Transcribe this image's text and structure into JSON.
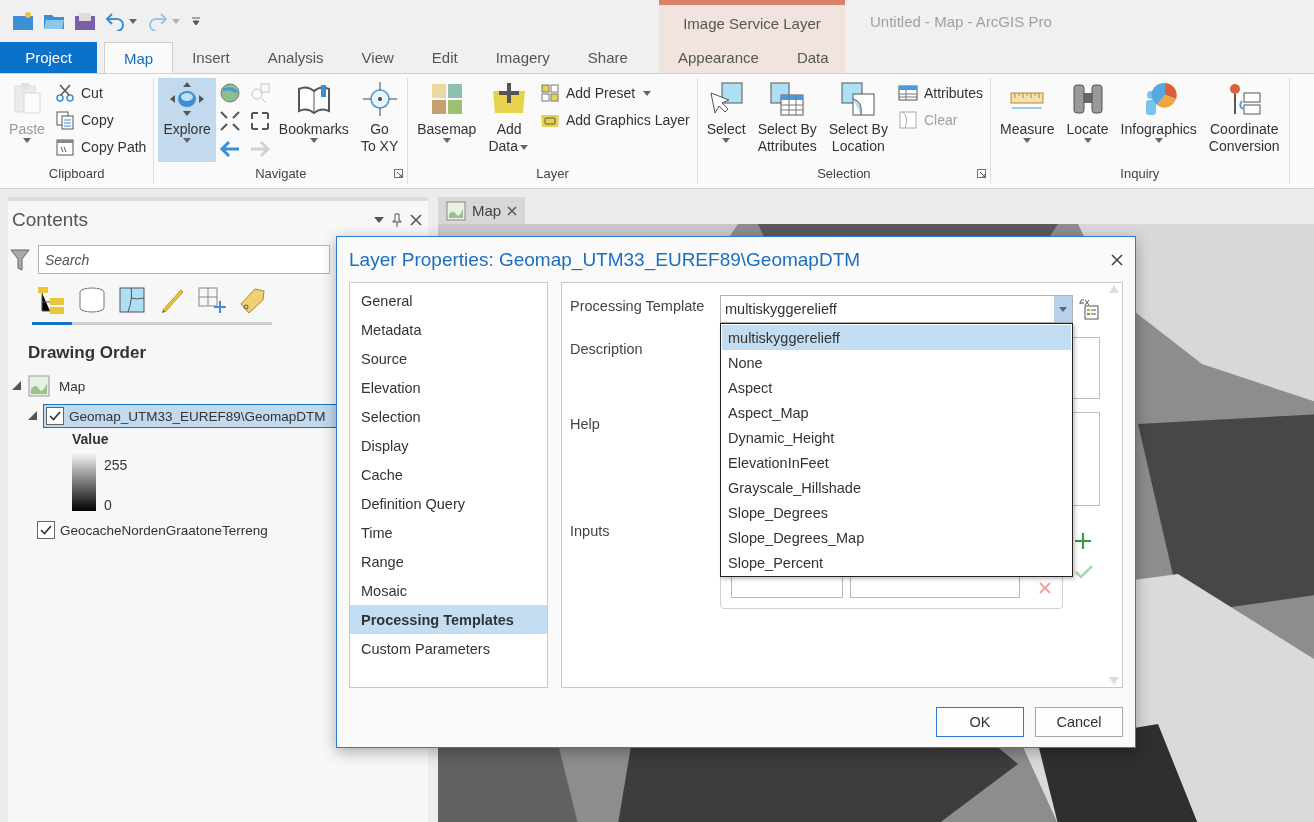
{
  "quick_access": [
    {
      "disabled": false
    },
    {
      "disabled": false
    },
    {
      "disabled": false
    },
    {
      "disabled": false
    },
    {
      "disabled": true
    }
  ],
  "context_tabs": {
    "title": "Image Service Layer",
    "tabs": [
      {
        "label": "Appearance",
        "selected": false
      },
      {
        "label": "Data",
        "selected": false
      }
    ]
  },
  "app_title": "Untitled - Map - ArcGIS Pro",
  "tabs": [
    {
      "label": "Project",
      "kind": "backstage",
      "selected": false
    },
    {
      "label": "Map",
      "kind": "tab",
      "selected": true
    },
    {
      "label": "Insert",
      "kind": "tab",
      "selected": false
    },
    {
      "label": "Analysis",
      "kind": "tab",
      "selected": false
    },
    {
      "label": "View",
      "kind": "tab",
      "selected": false
    },
    {
      "label": "Edit",
      "kind": "tab",
      "selected": false
    },
    {
      "label": "Imagery",
      "kind": "tab",
      "selected": false
    },
    {
      "label": "Share",
      "kind": "tab",
      "selected": false
    }
  ],
  "ribbon": {
    "groups": [
      {
        "title": "Clipboard",
        "launcher": false,
        "items": [
          {
            "kind": "large",
            "lines": [
              "Paste"
            ],
            "dropdown": true,
            "disabled": true,
            "selected": false
          },
          {
            "kind": "stack",
            "buttons": [
              {
                "label": "Cut",
                "disabled": false,
                "dropdown": false
              },
              {
                "label": "Copy",
                "disabled": false,
                "dropdown": false
              },
              {
                "label": "Copy Path",
                "disabled": false,
                "dropdown": false
              }
            ]
          }
        ]
      },
      {
        "title": "Navigate",
        "launcher": true,
        "items": [
          {
            "kind": "large",
            "lines": [
              "Explore"
            ],
            "dropdown": true,
            "disabled": false,
            "selected": true
          },
          {
            "kind": "grid",
            "buttons": [
              {
                "disabled": false
              },
              {
                "disabled": true
              },
              {
                "disabled": false
              },
              {
                "disabled": false
              },
              {
                "disabled": false
              },
              {
                "disabled": true
              }
            ]
          },
          {
            "kind": "large",
            "lines": [
              "Bookmarks"
            ],
            "dropdown": true,
            "disabled": false,
            "selected": false
          },
          {
            "kind": "large",
            "lines": [
              "Go",
              "To XY"
            ],
            "dropdown": false,
            "disabled": false,
            "selected": false
          }
        ]
      },
      {
        "title": "Layer",
        "launcher": false,
        "items": [
          {
            "kind": "large",
            "lines": [
              "Basemap"
            ],
            "dropdown": true,
            "disabled": false,
            "selected": false
          },
          {
            "kind": "large",
            "lines": [
              "Add",
              "Data"
            ],
            "dropdown": true,
            "disabled": false,
            "selected": false
          },
          {
            "kind": "stack",
            "buttons": [
              {
                "label": "Add Preset",
                "disabled": false,
                "dropdown": true
              },
              {
                "label": "Add Graphics Layer",
                "disabled": false,
                "dropdown": false
              }
            ]
          }
        ]
      },
      {
        "title": "Selection",
        "launcher": true,
        "items": [
          {
            "kind": "large",
            "lines": [
              "Select"
            ],
            "dropdown": true,
            "disabled": false,
            "selected": false
          },
          {
            "kind": "large",
            "lines": [
              "Select By",
              "Attributes"
            ],
            "dropdown": false,
            "disabled": false,
            "selected": false
          },
          {
            "kind": "large",
            "lines": [
              "Select By",
              "Location"
            ],
            "dropdown": false,
            "disabled": false,
            "selected": false
          },
          {
            "kind": "stack",
            "buttons": [
              {
                "label": "Attributes",
                "disabled": false,
                "dropdown": false
              },
              {
                "label": "Clear",
                "disabled": true,
                "dropdown": false
              }
            ]
          }
        ]
      },
      {
        "title": "Inquiry",
        "launcher": false,
        "items": [
          {
            "kind": "large",
            "lines": [
              "Measure"
            ],
            "dropdown": true,
            "disabled": false,
            "selected": false
          },
          {
            "kind": "large",
            "lines": [
              "Locate"
            ],
            "dropdown": true,
            "disabled": false,
            "selected": false
          },
          {
            "kind": "large",
            "lines": [
              "Infographics"
            ],
            "dropdown": true,
            "disabled": false,
            "selected": false
          },
          {
            "kind": "large",
            "lines": [
              "Coordinate",
              "Conversion"
            ],
            "dropdown": false,
            "disabled": false,
            "selected": false
          }
        ]
      }
    ]
  },
  "contents": {
    "title": "Contents",
    "search": {
      "placeholder": "Search"
    },
    "views": [
      {
        "selected": true
      },
      {
        "selected": false
      },
      {
        "selected": false
      },
      {
        "selected": false
      },
      {
        "selected": false
      },
      {
        "selected": false
      }
    ],
    "heading": "Drawing Order",
    "tree": [
      {
        "label": "Map",
        "kind": "map",
        "expanded": true,
        "children": [
          {
            "label": "Geomap_UTM33_EUREF89\\GeomapDTM",
            "kind": "layer",
            "checked": true,
            "selected": true,
            "expanded": true,
            "legend": {
              "title": "Value",
              "high": "255",
              "low": "0"
            }
          },
          {
            "label": "GeocacheNordenGraatoneTerreng",
            "kind": "layer",
            "checked": true,
            "selected": false
          }
        ]
      }
    ]
  },
  "map_view": {
    "tab": "Map"
  },
  "dialog": {
    "title": "Layer Properties: Geomap_UTM33_EUREF89\\GeomapDTM",
    "nav": [
      {
        "label": "General",
        "selected": false
      },
      {
        "label": "Metadata",
        "selected": false
      },
      {
        "label": "Source",
        "selected": false
      },
      {
        "label": "Elevation",
        "selected": false
      },
      {
        "label": "Selection",
        "selected": false
      },
      {
        "label": "Display",
        "selected": false
      },
      {
        "label": "Cache",
        "selected": false
      },
      {
        "label": "Definition Query",
        "selected": false
      },
      {
        "label": "Time",
        "selected": false
      },
      {
        "label": "Range",
        "selected": false
      },
      {
        "label": "Mosaic",
        "selected": false
      },
      {
        "label": "Processing Templates",
        "selected": true
      },
      {
        "label": "Custom Parameters",
        "selected": false
      }
    ],
    "form": {
      "template_label": "Processing Template",
      "template_value": "multiskyggerelieff",
      "dropdown_open": true,
      "options": [
        {
          "label": "multiskyggerelieff",
          "selected": true
        },
        {
          "label": "None",
          "selected": false
        },
        {
          "label": "Aspect",
          "selected": false
        },
        {
          "label": "Aspect_Map",
          "selected": false
        },
        {
          "label": "Dynamic_Height",
          "selected": false
        },
        {
          "label": "ElevationInFeet",
          "selected": false
        },
        {
          "label": "Grayscale_Hillshade",
          "selected": false
        },
        {
          "label": "Slope_Degrees",
          "selected": false
        },
        {
          "label": "Slope_Degrees_Map",
          "selected": false
        },
        {
          "label": "Slope_Percent",
          "selected": false
        }
      ],
      "description_label": "Description",
      "help_label": "Help",
      "inputs_label": "Inputs"
    },
    "buttons": [
      {
        "label": "OK",
        "default": true
      },
      {
        "label": "Cancel",
        "default": false
      }
    ]
  }
}
